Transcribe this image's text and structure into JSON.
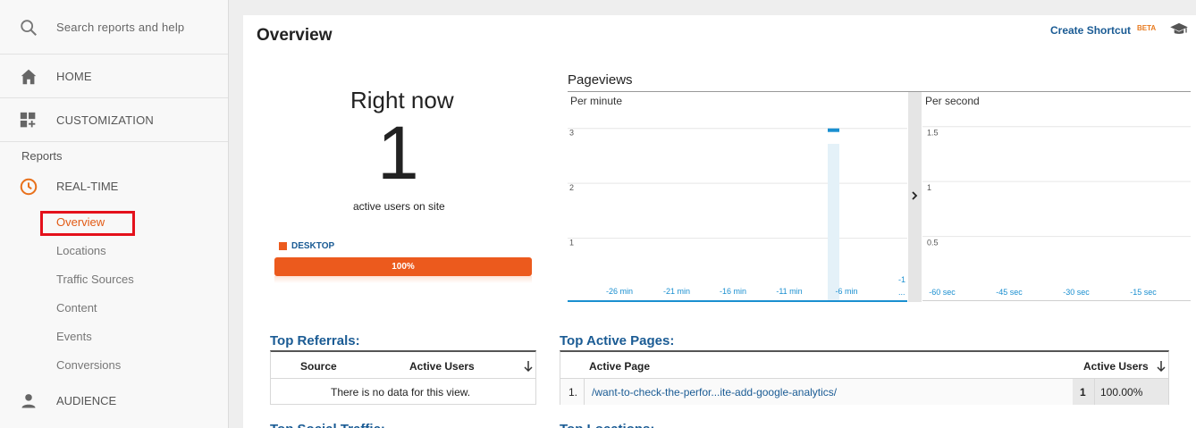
{
  "sidebar": {
    "search_placeholder": "Search reports and help",
    "home_label": "HOME",
    "customization_label": "CUSTOMIZATION",
    "reports_label": "Reports",
    "realtime_label": "REAL-TIME",
    "realtime_items": [
      "Overview",
      "Locations",
      "Traffic Sources",
      "Content",
      "Events",
      "Conversions"
    ],
    "audience_label": "AUDIENCE",
    "accent_color": "#e25a14"
  },
  "header": {
    "title": "Overview",
    "shortcut_label": "Create Shortcut",
    "beta_label": "BETA"
  },
  "right_now": {
    "title": "Right now",
    "count": "1",
    "subtitle": "active users on site",
    "device_label": "DESKTOP",
    "device_percent": "100%",
    "device_fraction": 1.0
  },
  "pageviews": {
    "title": "Pageviews",
    "per_minute_label": "Per minute",
    "per_second_label": "Per second"
  },
  "chart_data": [
    {
      "type": "bar",
      "title": "Per minute",
      "x": [
        "-26 min",
        "-21 min",
        "-16 min",
        "-11 min",
        "-6 min",
        "-1 ..."
      ],
      "yticks": [
        "1",
        "2",
        "3"
      ],
      "ylim": [
        0,
        3.5
      ],
      "bars": [
        {
          "x_minutes_ago": 6,
          "value": 3
        }
      ],
      "grid": true
    },
    {
      "type": "bar",
      "title": "Per second",
      "x": [
        "-60 sec",
        "-45 sec",
        "-30 sec",
        "-15 sec"
      ],
      "yticks": [
        "0.5",
        "1",
        "1.5"
      ],
      "ylim": [
        0,
        1.75
      ],
      "bars": [],
      "grid": true
    }
  ],
  "top_referrals": {
    "title": "Top Referrals:",
    "col_source": "Source",
    "col_users": "Active Users",
    "empty_text": "There is no data for this view."
  },
  "top_pages": {
    "title": "Top Active Pages:",
    "col_page": "Active Page",
    "col_users": "Active Users",
    "rows": [
      {
        "index": "1.",
        "page": "/want-to-check-the-perfor...ite-add-google-analytics/",
        "users": "1",
        "percent": "100.00%"
      }
    ]
  },
  "below": {
    "social_title": "Top Social Traffic:",
    "locations_title": "Top Locations:"
  },
  "colors": {
    "brand_blue": "#1a5b94",
    "bar_orange": "#ec5a1d",
    "chart_blue": "#1a8fd0"
  }
}
